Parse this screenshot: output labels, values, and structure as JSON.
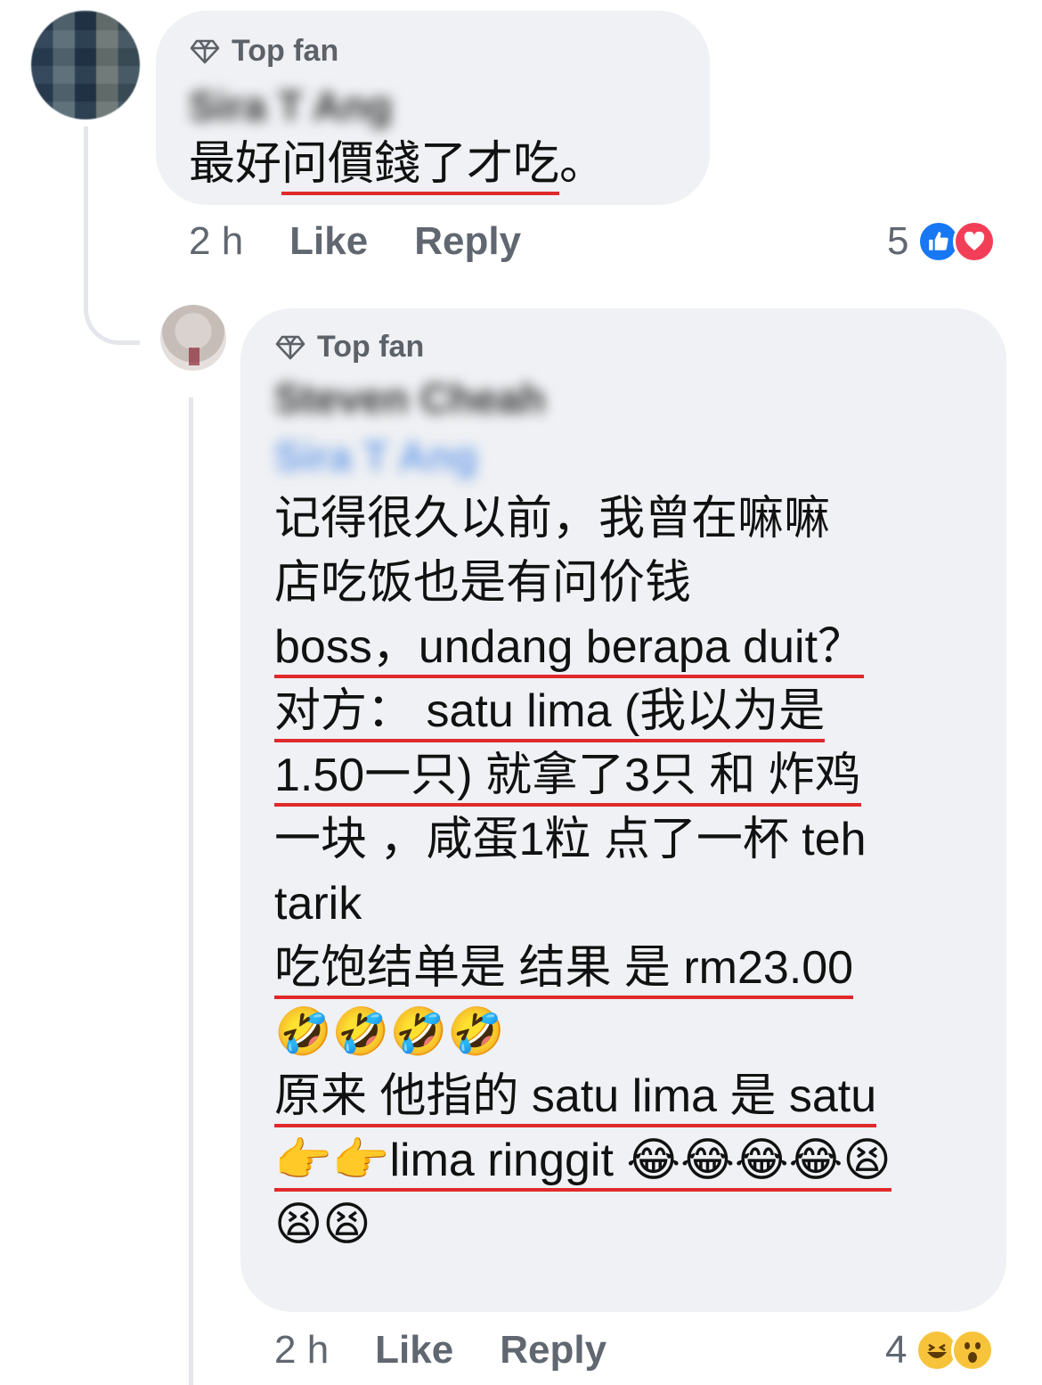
{
  "comment": {
    "badge": "Top fan",
    "author": "Sira T Ang",
    "text": "最好问價錢了才吃。",
    "time": "2 h",
    "like_label": "Like",
    "reply_label": "Reply",
    "reaction_count": "5",
    "reactions": [
      "like",
      "love"
    ]
  },
  "reply": {
    "badge": "Top fan",
    "author": "Steven Cheah",
    "mention": "Sira T Ang",
    "lines": [
      "记得很久以前，我曾在嘛嘛",
      "店吃饭也是有问价钱",
      "boss，undang berapa duit？",
      "对方： satu lima (我以为是",
      "1.50一只) 就拿了3只 和 炸鸡",
      "一块 ，咸蛋1粒 点了一杯 teh",
      "tarik",
      "吃饱结单是 结果 是 rm23.00",
      "🤣🤣🤣🤣",
      "原来 他指的 satu lima 是 satu",
      "👉👉lima ringgit 😂😂😂😂😫",
      "😫😫"
    ],
    "time": "2 h",
    "like_label": "Like",
    "reply_label": "Reply",
    "reaction_count": "4",
    "reactions": [
      "haha",
      "wow"
    ]
  },
  "colors": {
    "bubble": "#eff1f4",
    "thread_line": "#e4e6eb",
    "underline": "#e0292a",
    "meta_text": "#606770",
    "mention": "#6f9fe8"
  }
}
